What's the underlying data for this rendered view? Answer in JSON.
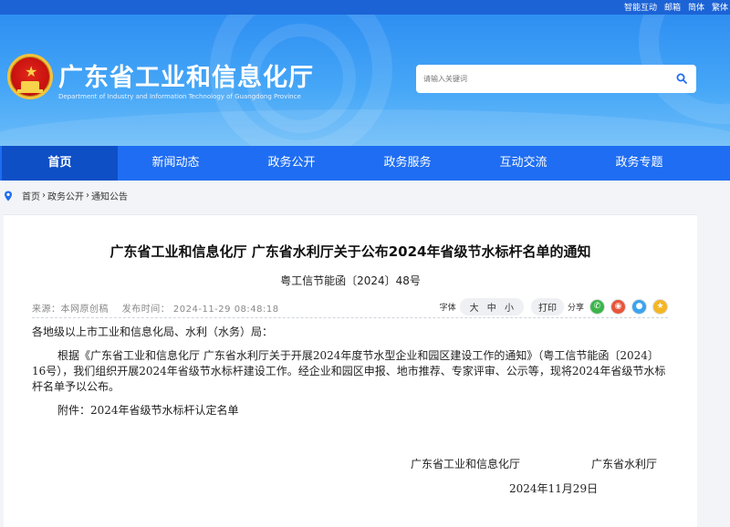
{
  "top_links": [
    "智能互动",
    "邮箱",
    "简体",
    "繁体"
  ],
  "site": {
    "title": "广东省工业和信息化厅",
    "subtitle": "Department of Industry and Information Technology of Guangdong Province"
  },
  "search": {
    "placeholder": "请输入关键词"
  },
  "nav": [
    "首页",
    "新闻动态",
    "政务公开",
    "政务服务",
    "互动交流",
    "政务专题"
  ],
  "breadcrumb": [
    "首页",
    "政务公开",
    "通知公告"
  ],
  "article": {
    "title": "广东省工业和信息化厅 广东省水利厅关于公布2024年省级节水标杆名单的通知",
    "doc_no": "粤工信节能函〔2024〕48号",
    "source": "来源：本网原创稿",
    "publish_time": "发布时间：  2024-11-29 08:48:18",
    "font_label": "字体",
    "font_sizes": [
      "大",
      "中",
      "小"
    ],
    "print_label": "打印",
    "share_label": "分享",
    "greeting": "各地级以上市工业和信息化局、水利（水务）局：",
    "paragraph": "根据《广东省工业和信息化厅 广东省水利厅关于开展2024年度节水型企业和园区建设工作的通知》（粤工信节能函〔2024〕16号），我们组织开展2024年省级节水标杆建设工作。经企业和园区申报、地市推荐、专家评审、公示等，现将2024年省级节水标杆名单予以公布。",
    "attachment": "附件：2024年省级节水标杆认定名单",
    "signer1": "广东省工业和信息化厅",
    "signer2": "广东省水利厅",
    "date": "2024年11月29日"
  },
  "colors": {
    "nav": "#1f6df2",
    "nav_active": "#0e4fc6",
    "topbar": "#1c63d6"
  },
  "icons": [
    "search-icon",
    "location-pin-icon",
    "wechat-icon",
    "weibo-icon",
    "qq-icon",
    "qzone-icon",
    "emblem-logo"
  ]
}
